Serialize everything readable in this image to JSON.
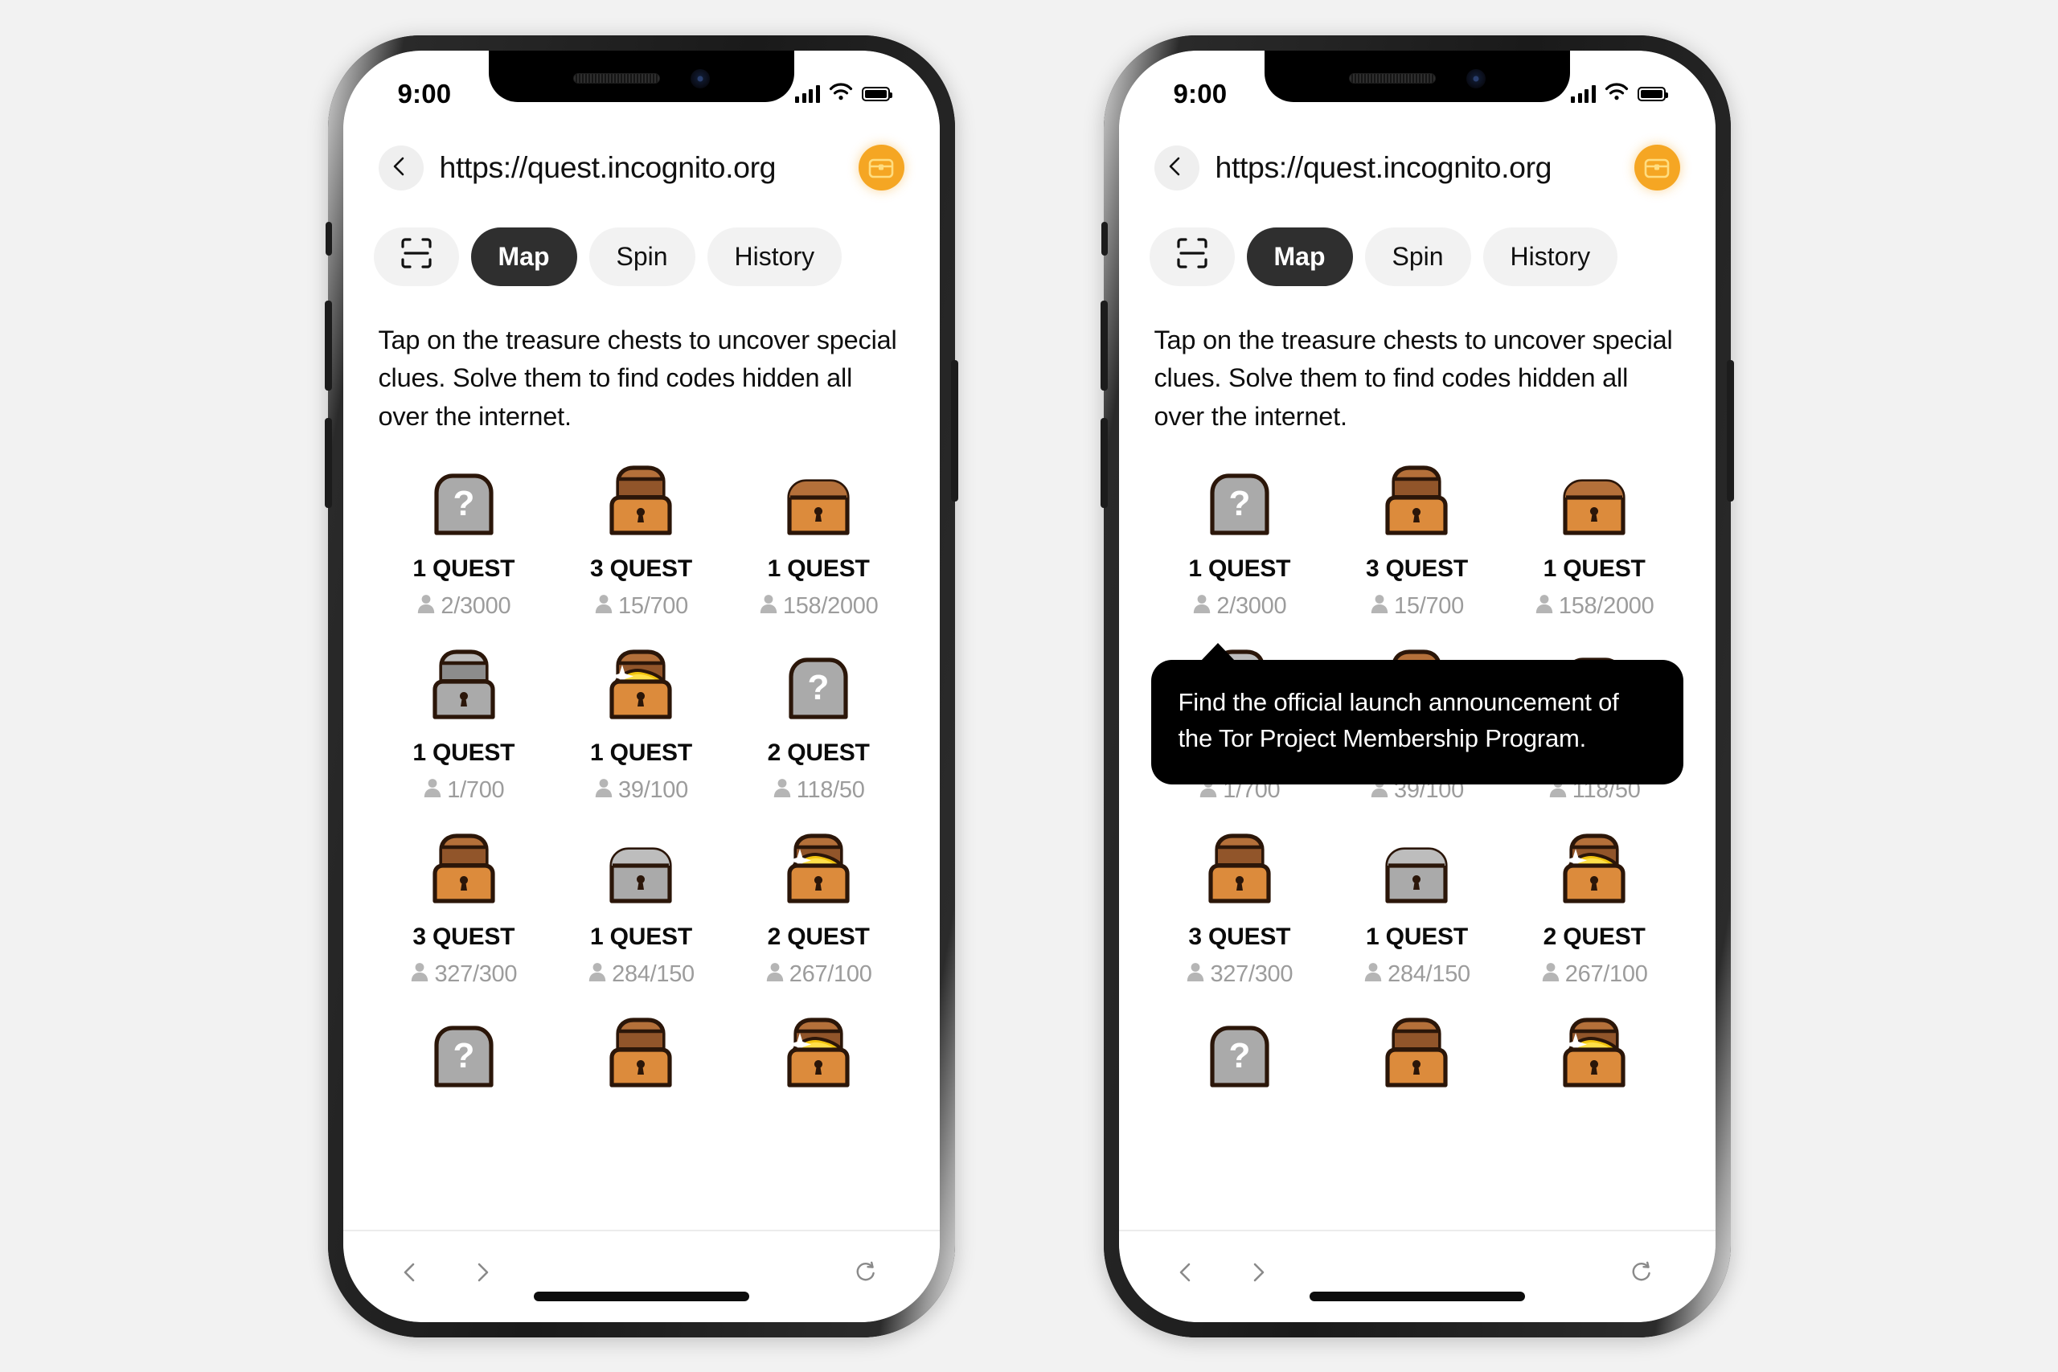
{
  "background_color": "#f2f2f2",
  "accent_color": "#f5a623",
  "chest_orange": "#dc8b3c",
  "chest_lid_brown": "#95582a",
  "chest_outline": "#3b1f10",
  "chest_gray": "#a8a8a8",
  "gold_color": "#f2c40e",
  "phones": [
    {
      "id": "phone-left",
      "status_bar": {
        "time": "9:00",
        "cellular_icon": "signal-bars-icon",
        "wifi_icon": "wifi-icon",
        "battery_icon": "battery-full-icon"
      },
      "url_bar": {
        "back_icon": "chevron-left-icon",
        "url": "https://quest.incognito.org",
        "action_icon": "treasure-chest-icon"
      },
      "tabs": [
        {
          "name": "tab-scan",
          "label": "",
          "icon": "scan-frame-icon",
          "active": false
        },
        {
          "name": "tab-map",
          "label": "Map",
          "icon": "",
          "active": true
        },
        {
          "name": "tab-spin",
          "label": "Spin",
          "icon": "",
          "active": false
        },
        {
          "name": "tab-history",
          "label": "History",
          "icon": "",
          "active": false
        }
      ],
      "description": "Tap on the treasure chests to uncover special clues. Solve them to find codes hidden all over the internet.",
      "tooltip": null,
      "chests": [
        {
          "chest_type": "unknown",
          "quest_label": "1 QUEST",
          "count": "2/3000"
        },
        {
          "chest_type": "open-empty",
          "quest_label": "3 QUEST",
          "count": "15/700"
        },
        {
          "chest_type": "closed",
          "quest_label": "1 QUEST",
          "count": "158/2000"
        },
        {
          "chest_type": "open-locked-gray",
          "quest_label": "1 QUEST",
          "count": "1/700"
        },
        {
          "chest_type": "open-gold",
          "quest_label": "1 QUEST",
          "count": "39/100"
        },
        {
          "chest_type": "unknown",
          "quest_label": "2 QUEST",
          "count": "118/50"
        },
        {
          "chest_type": "open-empty",
          "quest_label": "3 QUEST",
          "count": "327/300"
        },
        {
          "chest_type": "closed-gray",
          "quest_label": "1 QUEST",
          "count": "284/150"
        },
        {
          "chest_type": "open-gold",
          "quest_label": "2 QUEST",
          "count": "267/100"
        },
        {
          "chest_type": "unknown",
          "quest_label": "",
          "count": ""
        },
        {
          "chest_type": "open-empty",
          "quest_label": "",
          "count": ""
        },
        {
          "chest_type": "open-gold",
          "quest_label": "",
          "count": ""
        }
      ],
      "bottom_bar": {
        "back_icon": "chevron-left-icon",
        "forward_icon": "chevron-right-icon",
        "reload_icon": "reload-icon"
      }
    },
    {
      "id": "phone-right",
      "status_bar": {
        "time": "9:00",
        "cellular_icon": "signal-bars-icon",
        "wifi_icon": "wifi-icon",
        "battery_icon": "battery-full-icon"
      },
      "url_bar": {
        "back_icon": "chevron-left-icon",
        "url": "https://quest.incognito.org",
        "action_icon": "treasure-chest-icon"
      },
      "tabs": [
        {
          "name": "tab-scan",
          "label": "",
          "icon": "scan-frame-icon",
          "active": false
        },
        {
          "name": "tab-map",
          "label": "Map",
          "icon": "",
          "active": true
        },
        {
          "name": "tab-spin",
          "label": "Spin",
          "icon": "",
          "active": false
        },
        {
          "name": "tab-history",
          "label": "History",
          "icon": "",
          "active": false
        }
      ],
      "description": "Tap on the treasure chests to uncover special clues. Solve them to find codes hidden all over the internet.",
      "tooltip": {
        "text": "Find the official launch announcement of the Tor Project Membership Program."
      },
      "chests": [
        {
          "chest_type": "unknown",
          "quest_label": "1 QUEST",
          "count": "2/3000"
        },
        {
          "chest_type": "open-empty",
          "quest_label": "3 QUEST",
          "count": "15/700"
        },
        {
          "chest_type": "closed",
          "quest_label": "1 QUEST",
          "count": "158/2000"
        },
        {
          "chest_type": "open-locked-gray",
          "quest_label": "1 QUEST",
          "count": "1/700"
        },
        {
          "chest_type": "open-gold",
          "quest_label": "1 QUEST",
          "count": "39/100"
        },
        {
          "chest_type": "unknown",
          "quest_label": "2 QUEST",
          "count": "118/50"
        },
        {
          "chest_type": "open-empty",
          "quest_label": "3 QUEST",
          "count": "327/300"
        },
        {
          "chest_type": "closed-gray",
          "quest_label": "1 QUEST",
          "count": "284/150"
        },
        {
          "chest_type": "open-gold",
          "quest_label": "2 QUEST",
          "count": "267/100"
        },
        {
          "chest_type": "unknown",
          "quest_label": "",
          "count": ""
        },
        {
          "chest_type": "open-empty",
          "quest_label": "",
          "count": ""
        },
        {
          "chest_type": "open-gold",
          "quest_label": "",
          "count": ""
        }
      ],
      "bottom_bar": {
        "back_icon": "chevron-left-icon",
        "forward_icon": "chevron-right-icon",
        "reload_icon": "reload-icon"
      }
    }
  ]
}
